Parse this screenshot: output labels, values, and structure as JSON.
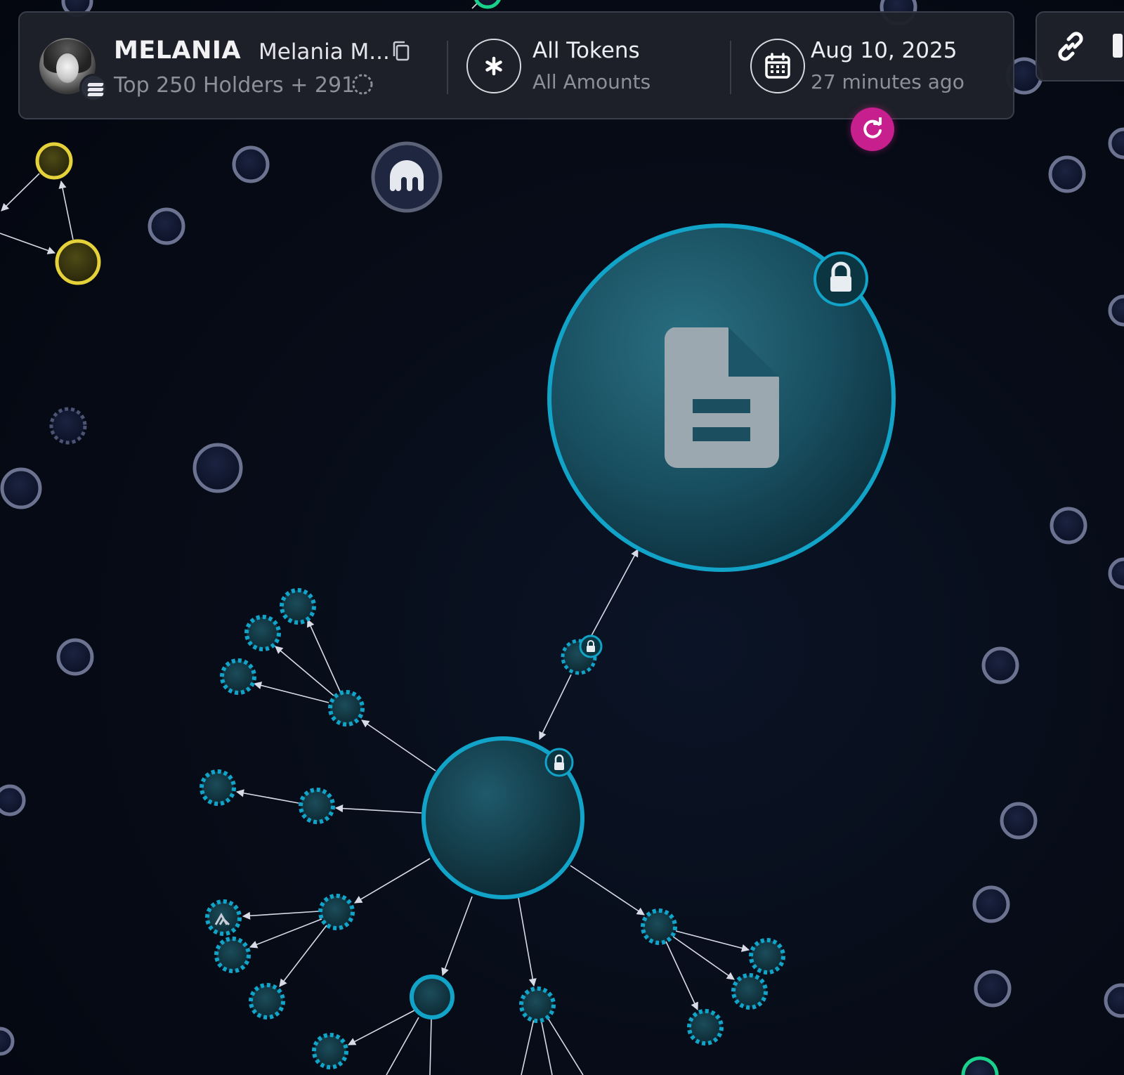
{
  "header": {
    "token_symbol": "MELANIA",
    "token_name": "Melania M...",
    "holders_label": "Top 250 Holders + 291",
    "filter": {
      "title": "All Tokens",
      "subtitle": "All Amounts"
    },
    "date": {
      "title": "Aug 10, 2025",
      "subtitle": "27 minutes ago"
    }
  },
  "colors": {
    "accent_cyan": "#12a4c8",
    "node_gray": "#6c7390",
    "highlight_yellow": "#e5d23a",
    "refresh_magenta": "#c81f8e",
    "green_node": "#19d18a"
  },
  "icons": {
    "avatar": "token-avatar",
    "chain": "solana-icon",
    "copy": "copy-icon",
    "filter": "asterisk-icon",
    "calendar": "calendar-icon",
    "refresh": "refresh-icon",
    "share": "link-icon",
    "exchange_node": "kraken-icon",
    "contract_node": "document-icon",
    "lock": "lock-icon"
  }
}
